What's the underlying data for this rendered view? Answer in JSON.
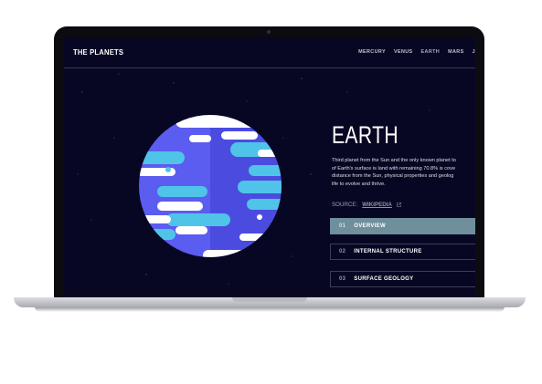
{
  "header": {
    "logo": "THE PLANETS",
    "nav": [
      "MERCURY",
      "VENUS",
      "EARTH",
      "MARS",
      "J"
    ],
    "active_nav": "EARTH"
  },
  "planet": {
    "name": "EARTH",
    "description_lines": [
      "Third planet from the Sun and the only known planet to",
      "of Earth's surface is land with remaining 70.8% is cove",
      "distance from the Sun, physical properties and geolog",
      "life to evolve and thrive."
    ],
    "source_label": "SOURCE:",
    "source_link": "WIKIPEDIA"
  },
  "tabs": [
    {
      "num": "01",
      "label": "OVERVIEW",
      "active": true
    },
    {
      "num": "02",
      "label": "INTERNAL STRUCTURE",
      "active": false
    },
    {
      "num": "03",
      "label": "SURFACE GEOLOGY",
      "active": false
    }
  ],
  "colors": {
    "background": "#070724",
    "earth_accent": "#6f8f9c",
    "earth_blue": "#5b5cf0",
    "earth_cyan": "#4fc4e8",
    "cloud_white": "#ffffff"
  }
}
